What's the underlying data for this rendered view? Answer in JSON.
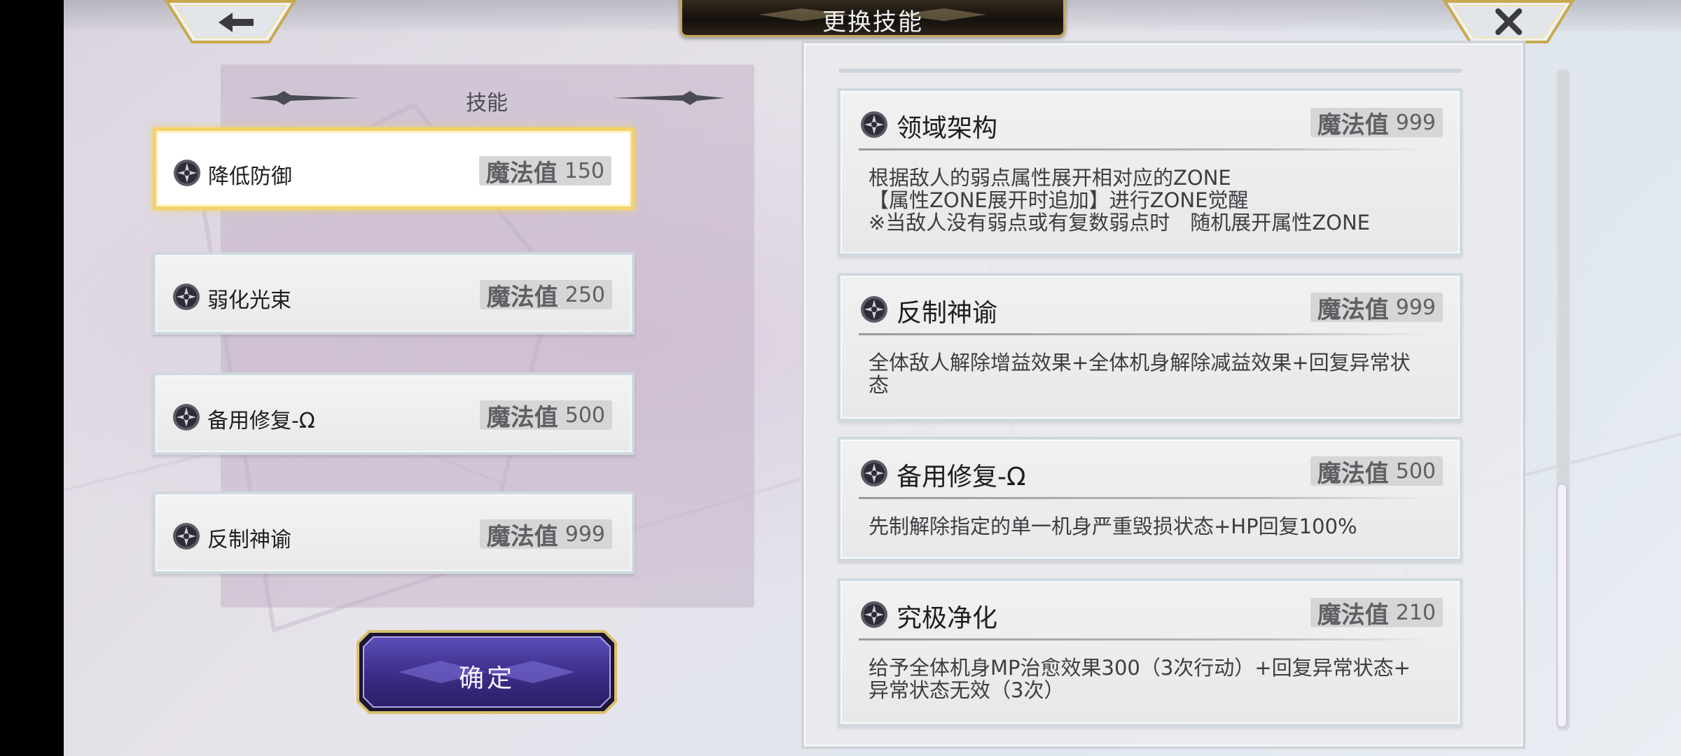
{
  "header": {
    "title": "更换技能",
    "back_icon": "arrow-left-icon",
    "close_icon": "close-x-icon"
  },
  "equipped": {
    "heading": "技能",
    "slots": [
      {
        "name": "降低防御",
        "mp_label": "魔法值",
        "mp": "150",
        "selected": true
      },
      {
        "name": "弱化光束",
        "mp_label": "魔法值",
        "mp": "250",
        "selected": false
      },
      {
        "name": "备用修复-Ω",
        "mp_label": "魔法值",
        "mp": "500",
        "selected": false
      },
      {
        "name": "反制神谕",
        "mp_label": "魔法值",
        "mp": "999",
        "selected": false
      }
    ],
    "confirm_label": "确定"
  },
  "skill_list": {
    "cards": [
      {
        "name": "领域架构",
        "mp_label": "魔法值",
        "mp": "999",
        "description": "根据敌人的弱点属性展开相对应的ZONE\n【属性ZONE展开时追加】进行ZONE觉醒\n※当敌人没有弱点或有复数弱点时　随机展开属性ZONE"
      },
      {
        "name": "反制神谕",
        "mp_label": "魔法值",
        "mp": "999",
        "description": "全体敌人解除增益效果+全体机身解除减益效果+回复异常状\n态"
      },
      {
        "name": "备用修复-Ω",
        "mp_label": "魔法值",
        "mp": "500",
        "description": "先制解除指定的单一机身严重毁损状态+HP回复100%"
      },
      {
        "name": "究极净化",
        "mp_label": "魔法值",
        "mp": "210",
        "description": "给予全体机身MP治愈效果300（3次行动）+回复异常状态+\n异常状态无效（3次）"
      }
    ]
  },
  "colors": {
    "selected_border": "#f3d36a",
    "title_plate": "#15110d",
    "title_trim": "#c5a85a",
    "confirm_button": "#3d2f8a"
  }
}
